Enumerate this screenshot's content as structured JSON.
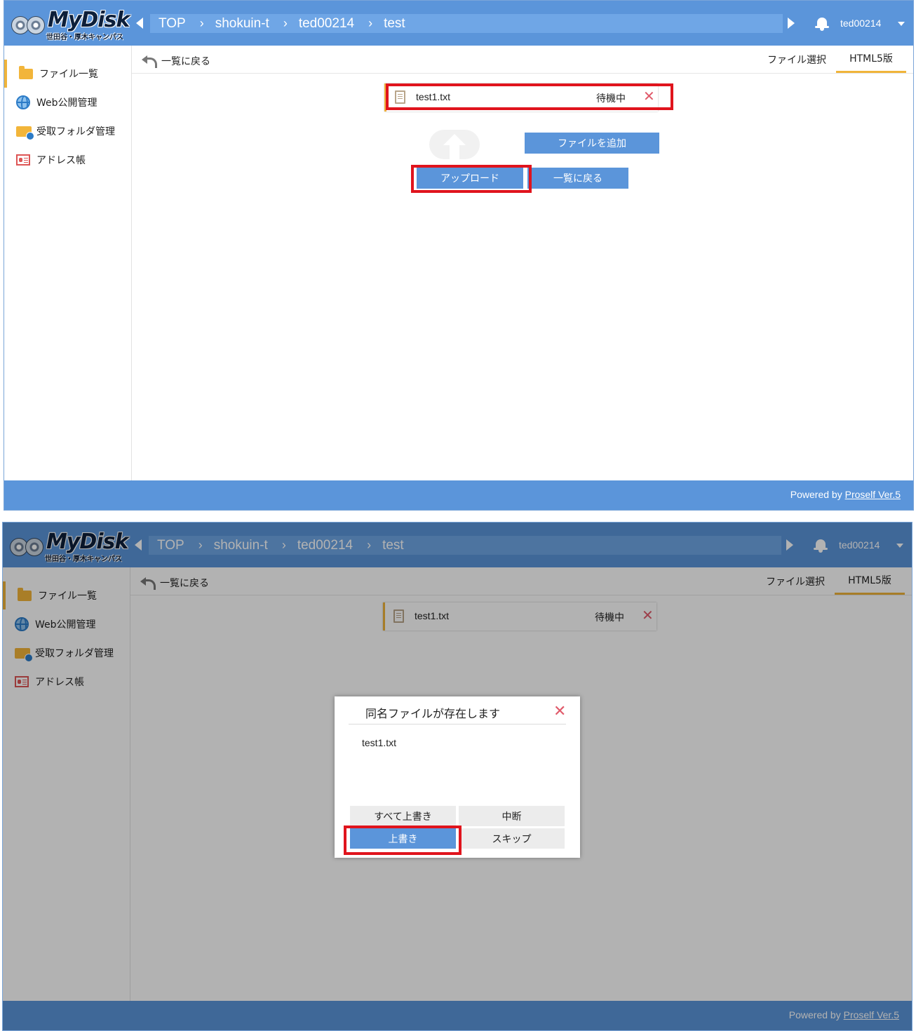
{
  "app": {
    "logo_title": "MyDisk",
    "logo_subtitle": "世田谷・厚木キャンパス",
    "breadcrumb": [
      "TOP",
      "shokuin-t",
      "ted00214",
      "test"
    ],
    "breadcrumb_sep": "›",
    "user": "ted00214",
    "sidebar": [
      {
        "label": "ファイル一覧",
        "icon": "folder-icon"
      },
      {
        "label": "Web公開管理",
        "icon": "globe-icon"
      },
      {
        "label": "受取フォルダ管理",
        "icon": "receive-folder-icon"
      },
      {
        "label": "アドレス帳",
        "icon": "address-book-icon"
      }
    ],
    "back_label": "一覧に戻る",
    "tabs": {
      "file_select": "ファイル選択",
      "html5": "HTML5版"
    },
    "file": {
      "name": "test1.txt",
      "status": "待機中",
      "remove": "✕"
    },
    "buttons": {
      "add_file": "ファイルを追加",
      "upload": "アップロード",
      "back_to_list": "一覧に戻る"
    },
    "footer": {
      "prefix": "Powered by ",
      "link": "Proself Ver.5"
    }
  },
  "dialog": {
    "title": "同名ファイルが存在します",
    "close": "✕",
    "filename": "test1.txt",
    "buttons": {
      "overwrite_all": "すべて上書き",
      "abort": "中断",
      "overwrite": "上書き",
      "skip": "スキップ"
    }
  },
  "colors": {
    "header": "#5b95da",
    "accent": "#f0b43a",
    "highlight": "#e0141d",
    "remove": "#e05a6a"
  }
}
